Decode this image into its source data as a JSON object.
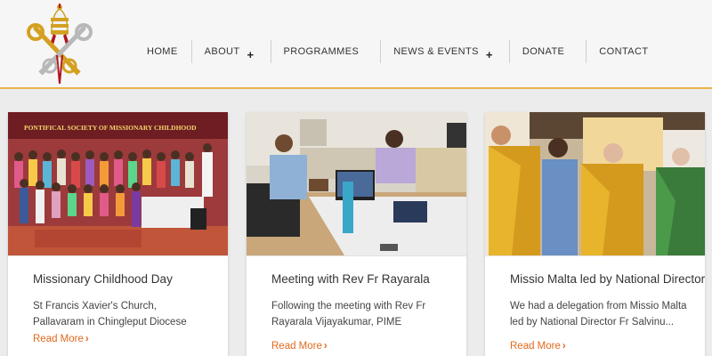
{
  "nav": {
    "items": [
      {
        "label": "HOME",
        "has_submenu": false
      },
      {
        "label": "ABOUT",
        "has_submenu": true
      },
      {
        "label": "PROGRAMMES",
        "has_submenu": false
      },
      {
        "label": "NEWS & EVENTS",
        "has_submenu": true
      },
      {
        "label": "DONATE",
        "has_submenu": false
      },
      {
        "label": "CONTACT",
        "has_submenu": false
      }
    ],
    "submenu_icon": "+"
  },
  "cards": [
    {
      "image_banner": "PONTIFICAL SOCIETY OF MISSIONARY CHILDHOOD",
      "title": "Missionary Childhood Day",
      "text": "St Francis Xavier's Church, Pallavaram in Chingleput Diocese",
      "read_more": "Read More"
    },
    {
      "title": "Meeting with Rev Fr Rayarala",
      "text": "Following the meeting with Rev Fr Rayarala Vijayakumar, PIME",
      "read_more": "Read More"
    },
    {
      "title": "Missio Malta led by National Director",
      "text": "We had a delegation from Missio Malta led by National Director Fr Salvinu...",
      "read_more": "Read More"
    }
  ],
  "colors": {
    "accent_orange": "#e06a1c",
    "header_line": "#e8b44a",
    "banner_red": "#7a1f24"
  },
  "icons": {
    "logo": "papal-keys-tiara-emblem",
    "read_more": "chevron-right-icon"
  }
}
